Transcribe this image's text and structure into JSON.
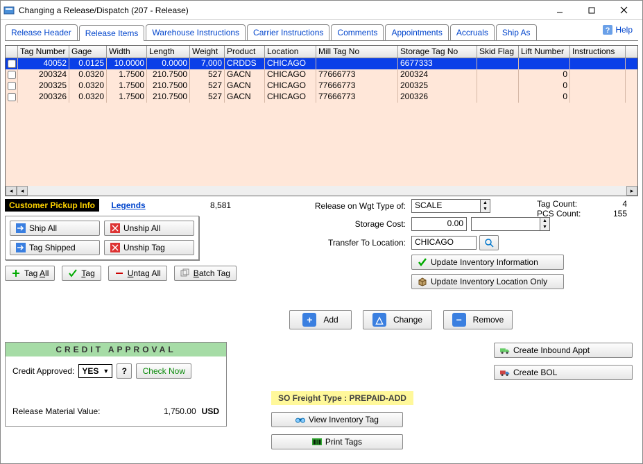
{
  "window": {
    "title": "Changing a Release/Dispatch  (207 - Release)"
  },
  "help": {
    "label": "Help"
  },
  "tabs": [
    {
      "label": "Release Header",
      "active": false
    },
    {
      "label": "Release Items",
      "active": true
    },
    {
      "label": "Warehouse Instructions",
      "active": false
    },
    {
      "label": "Carrier Instructions",
      "active": false
    },
    {
      "label": "Comments",
      "active": false
    },
    {
      "label": "Appointments",
      "active": false
    },
    {
      "label": "Accruals",
      "active": false
    },
    {
      "label": "Ship As",
      "active": false
    }
  ],
  "grid": {
    "columns": [
      "Tag Number",
      "Gage",
      "Width",
      "Length",
      "Weight",
      "Product",
      "Location",
      "Mill Tag No",
      "Storage Tag No",
      "Skid Flag",
      "Lift Number",
      "Instructions"
    ],
    "rows": [
      {
        "selected": true,
        "checked": false,
        "tag": "40052",
        "gage": "0.0125",
        "width": "10.0000",
        "length": "0.0000",
        "weight": "7,000",
        "product": "CRDDS",
        "location": "CHICAGO",
        "mill": "",
        "storage": "6677333",
        "skid": "",
        "lift": "",
        "inst": ""
      },
      {
        "selected": false,
        "checked": false,
        "tag": "200324",
        "gage": "0.0320",
        "width": "1.7500",
        "length": "210.7500",
        "weight": "527",
        "product": "GACN",
        "location": "CHICAGO",
        "mill": "77666773",
        "storage": "200324",
        "skid": "",
        "lift": "0",
        "inst": ""
      },
      {
        "selected": false,
        "checked": false,
        "tag": "200325",
        "gage": "0.0320",
        "width": "1.7500",
        "length": "210.7500",
        "weight": "527",
        "product": "GACN",
        "location": "CHICAGO",
        "mill": "77666773",
        "storage": "200325",
        "skid": "",
        "lift": "0",
        "inst": ""
      },
      {
        "selected": false,
        "checked": false,
        "tag": "200326",
        "gage": "0.0320",
        "width": "1.7500",
        "length": "210.7500",
        "weight": "527",
        "product": "GACN",
        "location": "CHICAGO",
        "mill": "77666773",
        "storage": "200326",
        "skid": "",
        "lift": "0",
        "inst": ""
      }
    ]
  },
  "summary": {
    "sum_value": "8,581",
    "cust_pickup_label": "Customer Pickup Info",
    "legends_label": "Legends"
  },
  "ship_panel": {
    "ship_all": "Ship All",
    "unship_all": "Unship All",
    "tag_shipped": "Tag Shipped",
    "unship_tag": "Unship Tag"
  },
  "tag_buttons": {
    "tag_all": "Tag All",
    "tag": "Tag",
    "untag_all": "Untag All",
    "batch_tag": "Batch Tag"
  },
  "right_form": {
    "wgt_type_label": "Release on Wgt Type of:",
    "wgt_type_value": "SCALE",
    "storage_cost_label": "Storage Cost:",
    "storage_cost_value": "0.00",
    "storage_cost_value2": "",
    "transfer_label": "Transfer To Location:",
    "transfer_value": "CHICAGO",
    "update_inv": "Update Inventory Information",
    "update_loc": "Update Inventory Location Only"
  },
  "counts": {
    "tag_count_label": "Tag Count:",
    "tag_count": "4",
    "pcs_count_label": "PCS Count:",
    "pcs_count": "155"
  },
  "mid_buttons": {
    "add": "Add",
    "change": "Change",
    "remove": "Remove"
  },
  "right_lower": {
    "create_inbound": "Create Inbound Appt",
    "create_bol": "Create BOL"
  },
  "credit": {
    "header": "CREDIT  APPROVAL",
    "approved_label": "Credit Approved:",
    "approved_value": "YES",
    "q_label": "?",
    "check_now": "Check Now",
    "rmv_label": "Release Material Value:",
    "rmv_value": "1,750.00",
    "rmv_ccy": "USD"
  },
  "freight": {
    "label": "SO Freight Type : PREPAID-ADD"
  },
  "lower_center": {
    "view_inv": "View Inventory Tag",
    "print_tags": "Print Tags"
  }
}
